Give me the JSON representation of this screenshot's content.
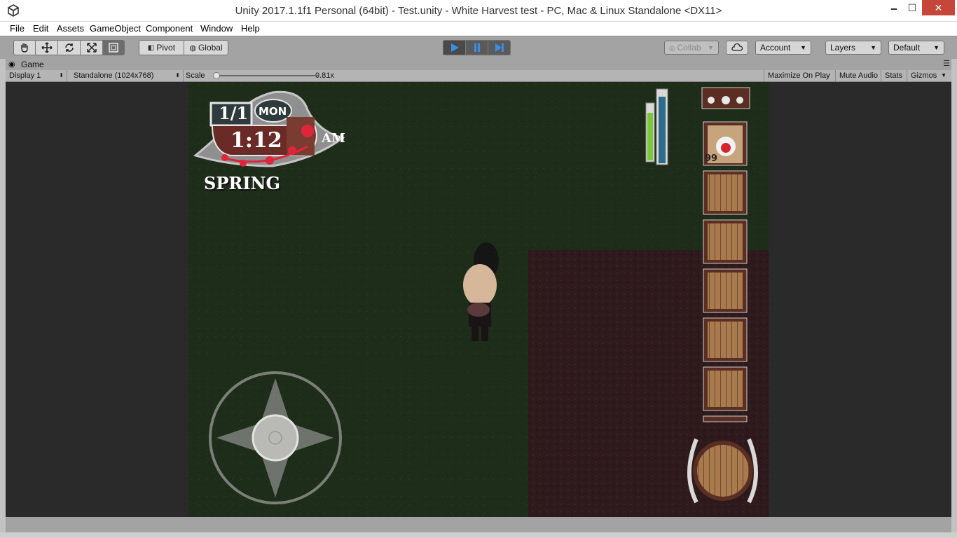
{
  "window": {
    "title": "Unity 2017.1.1f1 Personal (64bit) - Test.unity - White Harvest test - PC, Mac & Linux Standalone <DX11>",
    "minimize": "🗕",
    "maximize": "☐",
    "close": "✕"
  },
  "menu": {
    "items": [
      "File",
      "Edit",
      "Assets",
      "GameObject",
      "Component",
      "Window",
      "Help"
    ]
  },
  "toolbar": {
    "pivot": "Pivot",
    "global": "Global",
    "collab": "Collab",
    "account": "Account",
    "layers": "Layers",
    "layout": "Default"
  },
  "game_panel": {
    "tab_title": "Game",
    "display": "Display 1",
    "resolution": "Standalone (1024x768)",
    "scale_label": "Scale",
    "scale_value": "0.81x",
    "maximize_on_play": "Maximize On Play",
    "mute_audio": "Mute Audio",
    "stats": "Stats",
    "gizmos": "Gizmos"
  },
  "hud": {
    "date": "1/1",
    "weekday": "MON",
    "time": "1:12",
    "meridiem": "AM",
    "season": "SPRING",
    "item_count": "99",
    "stamina_fraction": 0.85,
    "health_fraction": 0.95
  },
  "colors": {
    "grass": "#1e2d1a",
    "soil": "#2e1a1c",
    "wood": "#a87a4e",
    "wood_frame": "#5a2e22",
    "unity_blue": "#3b8ee8"
  }
}
